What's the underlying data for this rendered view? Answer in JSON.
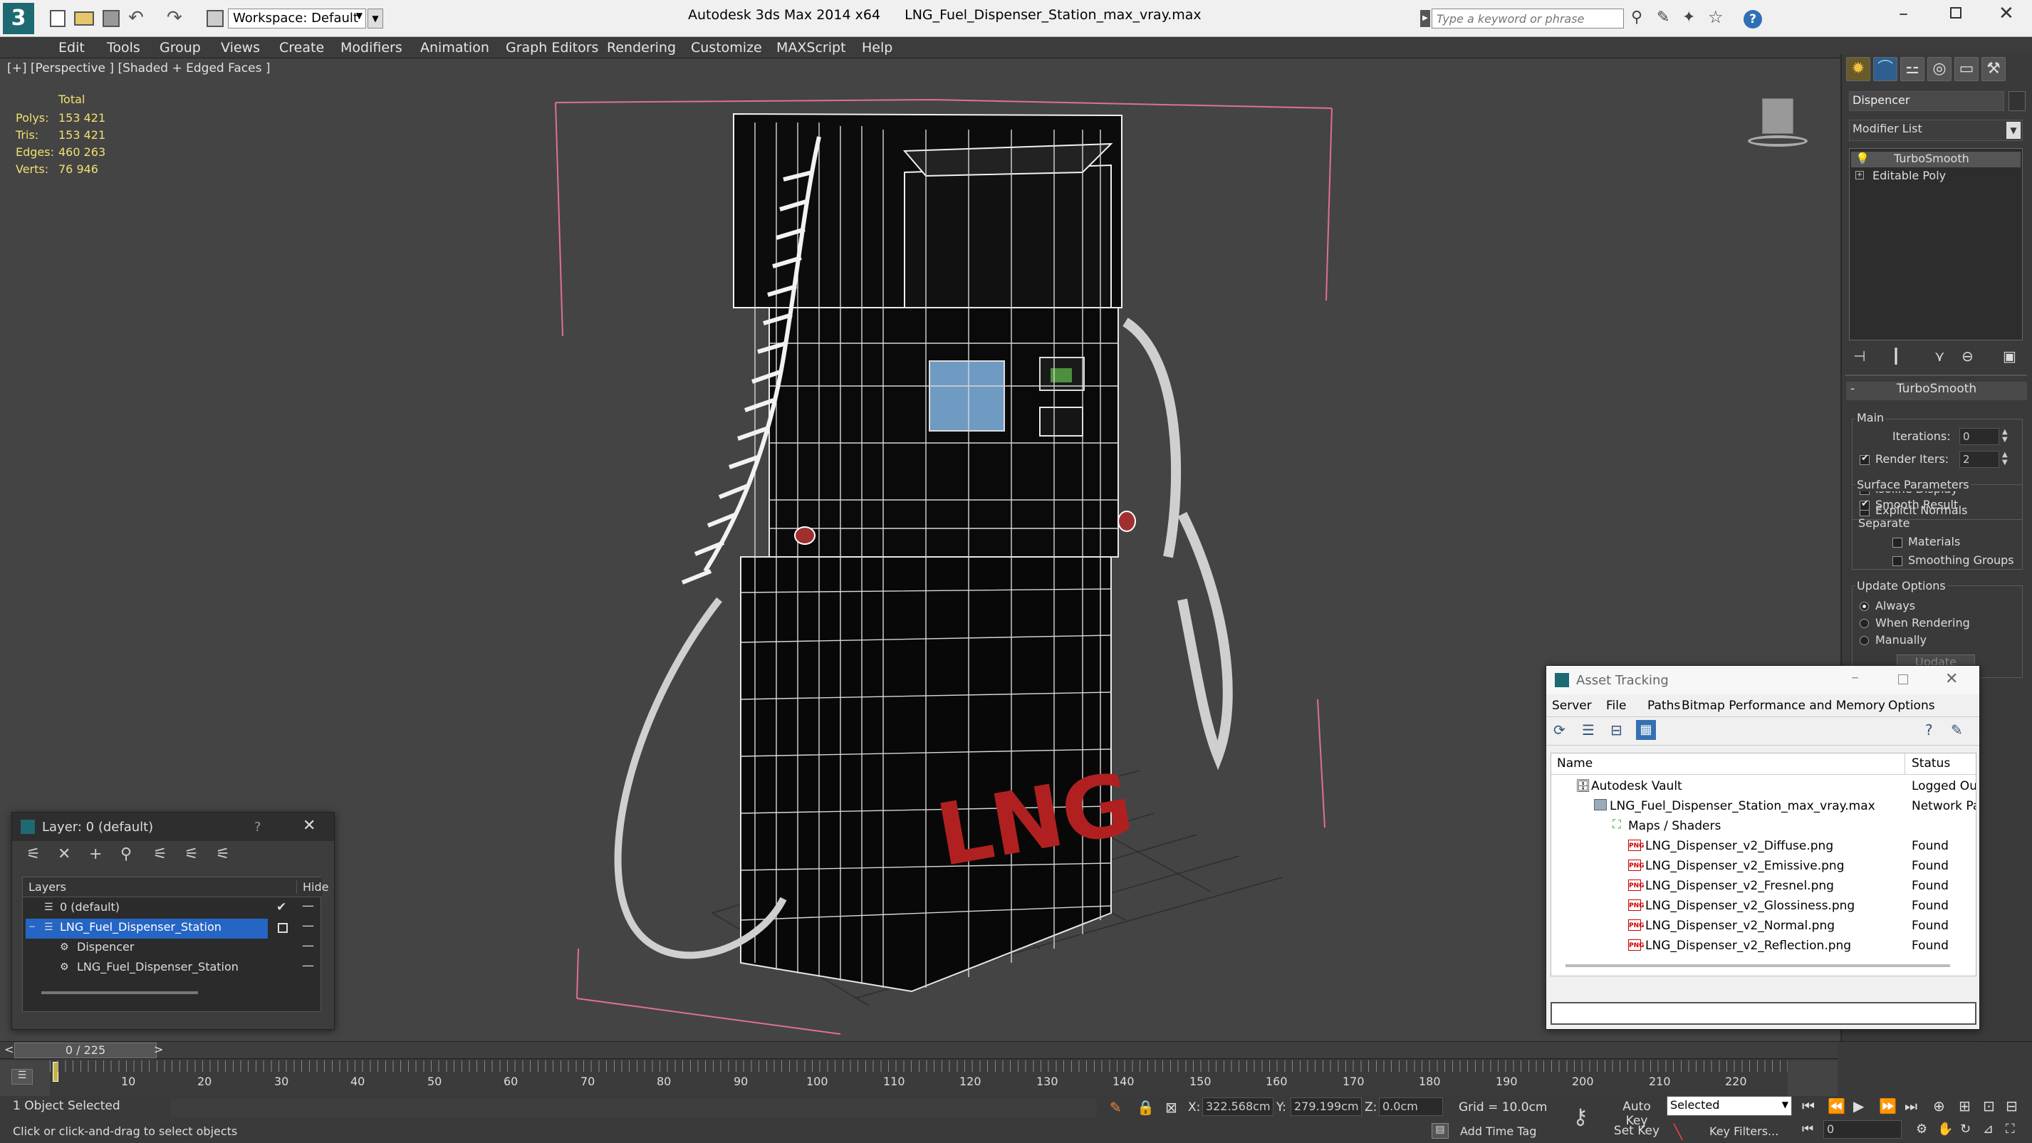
{
  "app_title": "Autodesk 3ds Max  2014 x64",
  "file_title": "LNG_Fuel_Dispenser_Station_max_vray.max",
  "workspace": "Workspace: Default",
  "search_placeholder": "Type a keyword or phrase",
  "menu": [
    "Edit",
    "Tools",
    "Group",
    "Views",
    "Create",
    "Modifiers",
    "Animation",
    "Graph Editors",
    "Rendering",
    "Customize",
    "MAXScript",
    "Help"
  ],
  "viewport": {
    "label": "[+] [Perspective ] [Shaded + Edged Faces ]",
    "stats_header": "Total",
    "stats": [
      {
        "k": "Polys:",
        "v": "153 421"
      },
      {
        "k": "Tris:",
        "v": "153 421"
      },
      {
        "k": "Edges:",
        "v": "460 263"
      },
      {
        "k": "Verts:",
        "v": "76 946"
      }
    ],
    "lng_text": "LNG"
  },
  "cmd_panel": {
    "object_name": "Dispencer",
    "modifier_list": "Modifier List",
    "stack": [
      "TurboSmooth",
      "Editable Poly"
    ],
    "rollout_title": "TurboSmooth",
    "main_label": "Main",
    "iterations_label": "Iterations:",
    "iterations_value": "0",
    "render_iters_label": "Render Iters:",
    "render_iters_value": "2",
    "isoline": "Isoline Display",
    "explicit_normals": "Explicit Normals",
    "surface_params": "Surface Parameters",
    "smooth_result": "Smooth Result",
    "separate": "Separate",
    "materials": "Materials",
    "smoothing_groups": "Smoothing Groups",
    "update_options": "Update Options",
    "always": "Always",
    "when_rendering": "When Rendering",
    "manually": "Manually",
    "update_btn": "Update"
  },
  "layer_window": {
    "title": "Layer: 0 (default)",
    "help": "?",
    "col_layers": "Layers",
    "col_hide": "Hide",
    "rows": [
      "0 (default)",
      "LNG_Fuel_Dispenser_Station",
      "Dispencer",
      "LNG_Fuel_Dispenser_Station"
    ]
  },
  "asset_window": {
    "title": "Asset Tracking",
    "menu": [
      "Server",
      "File",
      "Paths",
      "Bitmap Performance and Memory",
      "Options"
    ],
    "col_name": "Name",
    "col_status": "Status",
    "rows": [
      {
        "name": "Autodesk Vault",
        "status": "Logged Ou"
      },
      {
        "name": "LNG_Fuel_Dispenser_Station_max_vray.max",
        "status": "Network Pa"
      },
      {
        "name": "Maps / Shaders",
        "status": ""
      },
      {
        "name": "LNG_Dispenser_v2_Diffuse.png",
        "status": "Found"
      },
      {
        "name": "LNG_Dispenser_v2_Emissive.png",
        "status": "Found"
      },
      {
        "name": "LNG_Dispenser_v2_Fresnel.png",
        "status": "Found"
      },
      {
        "name": "LNG_Dispenser_v2_Glossiness.png",
        "status": "Found"
      },
      {
        "name": "LNG_Dispenser_v2_Normal.png",
        "status": "Found"
      },
      {
        "name": "LNG_Dispenser_v2_Reflection.png",
        "status": "Found"
      }
    ]
  },
  "timeline": {
    "frame": "0 / 225",
    "prev": "<",
    "next": ">",
    "ticks": [
      "10",
      "20",
      "30",
      "40",
      "50",
      "60",
      "70",
      "80",
      "90",
      "100",
      "110",
      "120",
      "130",
      "140",
      "150",
      "160",
      "170",
      "180",
      "190",
      "200",
      "210",
      "220"
    ]
  },
  "status": {
    "selected": "1 Object Selected",
    "prompt": "Click or click-and-drag to select objects",
    "x_label": "X:",
    "x_value": "322.568cm",
    "y_label": "Y:",
    "y_value": "279.199cm",
    "z_label": "Z:",
    "z_value": "0.0cm",
    "grid": "Grid = 10.0cm",
    "add_time_tag": "Add Time Tag",
    "auto_key": "Auto Key",
    "set_key": "Set Key",
    "selected_dropdown": "Selected",
    "key_filters": "Key Filters...",
    "frame_field": "0"
  }
}
